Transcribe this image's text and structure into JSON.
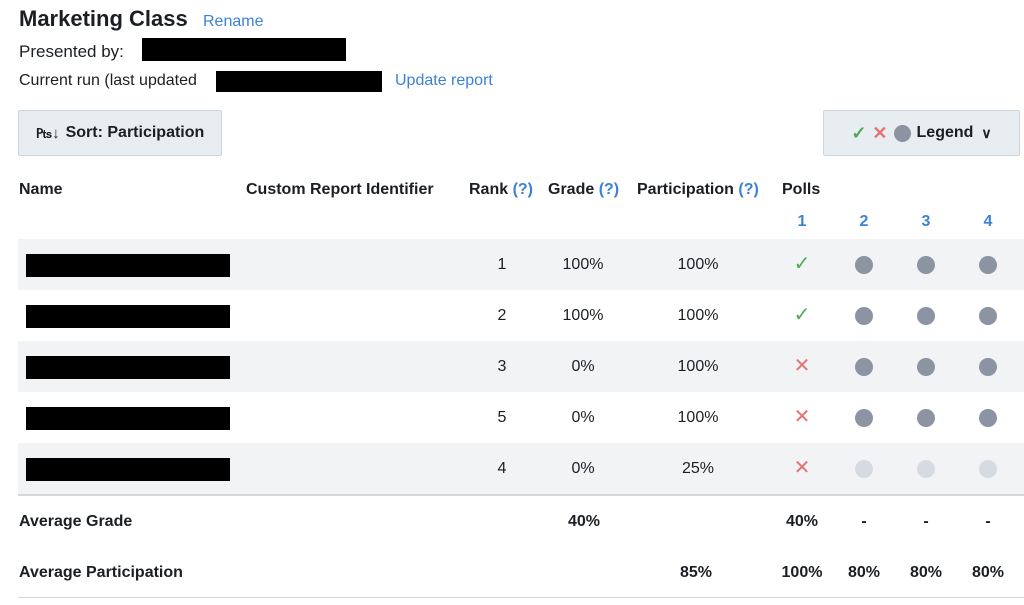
{
  "header": {
    "title": "Marketing Class",
    "rename_label": "Rename",
    "presented_by_label": "Presented by:",
    "current_run_label": "Current run (last updated",
    "update_report_label": "Update report"
  },
  "toolbar": {
    "sort_label": "Sort: Participation",
    "legend_label": "Legend",
    "legend_icons": [
      "check-icon",
      "x-icon",
      "dot-icon"
    ]
  },
  "table": {
    "columns": {
      "name": "Name",
      "custom_id": "Custom Report Identifier",
      "rank": "Rank",
      "grade": "Grade",
      "participation": "Participation",
      "polls": "Polls",
      "help": "(?)"
    },
    "poll_numbers": [
      "1",
      "2",
      "3",
      "4"
    ],
    "rows": [
      {
        "rank": "1",
        "grade": "100%",
        "participation": "100%",
        "polls": [
          "correct",
          "answered",
          "answered",
          "answered"
        ]
      },
      {
        "rank": "2",
        "grade": "100%",
        "participation": "100%",
        "polls": [
          "correct",
          "answered",
          "answered",
          "answered"
        ]
      },
      {
        "rank": "3",
        "grade": "0%",
        "participation": "100%",
        "polls": [
          "incorrect",
          "answered",
          "answered",
          "answered"
        ]
      },
      {
        "rank": "5",
        "grade": "0%",
        "participation": "100%",
        "polls": [
          "incorrect",
          "answered",
          "answered",
          "answered"
        ]
      },
      {
        "rank": "4",
        "grade": "0%",
        "participation": "25%",
        "polls": [
          "incorrect",
          "unanswered",
          "unanswered",
          "unanswered"
        ]
      }
    ]
  },
  "footer": {
    "average_grade_label": "Average Grade",
    "average_grade": "40%",
    "average_grade_polls": [
      "40%",
      "-",
      "-",
      "-"
    ],
    "average_participation_label": "Average Participation",
    "average_participation": "85%",
    "average_participation_polls": [
      "100%",
      "80%",
      "80%",
      "80%"
    ]
  },
  "colors": {
    "link": "#3b82d6",
    "correct": "#4caf50",
    "incorrect": "#e57373",
    "answered_dot": "#8c93a3",
    "unanswered_dot": "#d6dbe3"
  }
}
